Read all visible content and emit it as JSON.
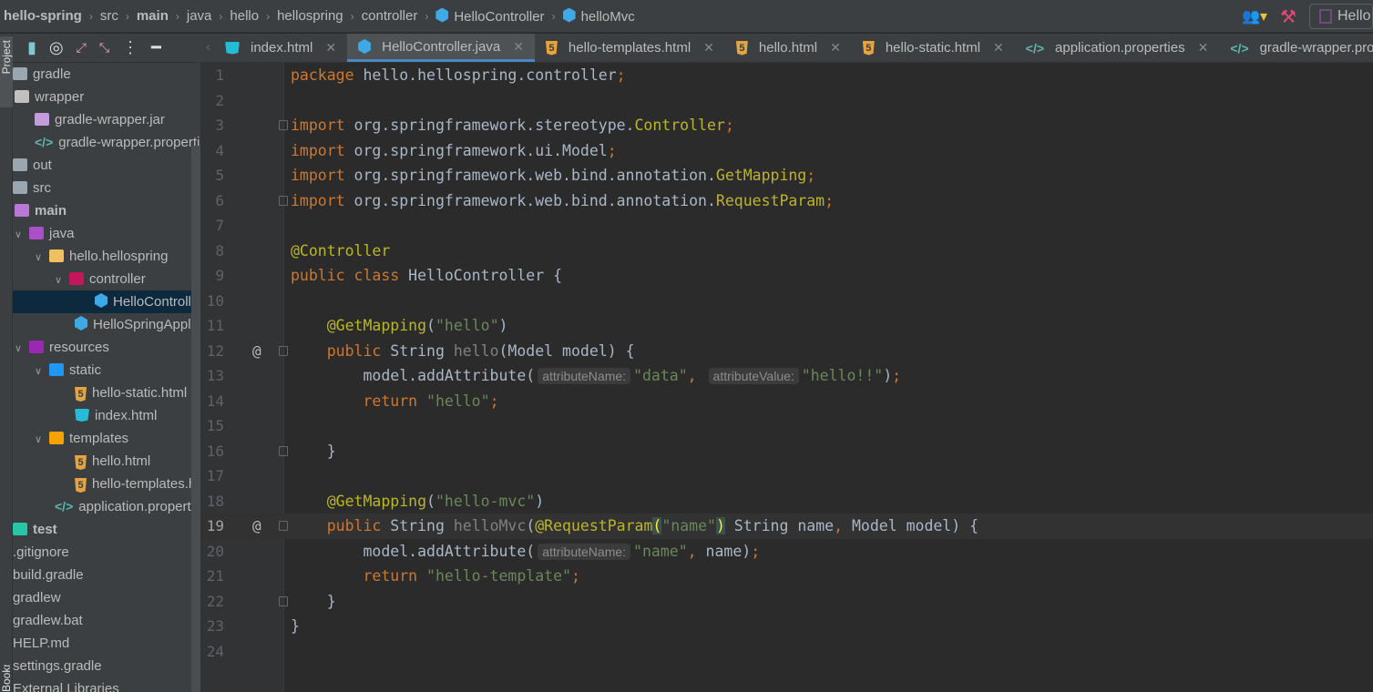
{
  "breadcrumb": [
    {
      "t": "hello-spring",
      "b": true
    },
    {
      "t": "src"
    },
    {
      "t": "main",
      "b": true
    },
    {
      "t": "java"
    },
    {
      "t": "hello"
    },
    {
      "t": "hellospring"
    },
    {
      "t": "controller"
    },
    {
      "t": "HelloController",
      "icon": "class"
    },
    {
      "t": "helloMvc",
      "icon": "method"
    }
  ],
  "run_config": "Hello",
  "left_stripe": {
    "project": "Project",
    "bookmarks": "Bookmarks"
  },
  "tree": [
    {
      "label": "gradle",
      "d": 0,
      "ico": "folder"
    },
    {
      "label": "wrapper",
      "d": 1,
      "ico": "folder-grey"
    },
    {
      "label": "gradle-wrapper.jar",
      "d": 2,
      "ico": "jar"
    },
    {
      "label": "gradle-wrapper.properties",
      "d": 2,
      "ico": "xml"
    },
    {
      "label": "out",
      "d": 0,
      "ico": "folder"
    },
    {
      "label": "src",
      "d": 0,
      "ico": "folder"
    },
    {
      "label": "main",
      "d": 1,
      "ico": "folder-src",
      "bold": true
    },
    {
      "label": "java",
      "d": 1,
      "ico": "folder-java",
      "arrow": true
    },
    {
      "label": "hello.hellospring",
      "d": 2,
      "ico": "package",
      "arrow": true
    },
    {
      "label": "controller",
      "d": 3,
      "ico": "package-spring",
      "arrow": true
    },
    {
      "label": "HelloController",
      "d": 5,
      "ico": "class",
      "selected": true
    },
    {
      "label": "HelloSpringApplication",
      "d": 4,
      "ico": "class-run"
    },
    {
      "label": "resources",
      "d": 1,
      "ico": "folder-res",
      "arrow": true
    },
    {
      "label": "static",
      "d": 2,
      "ico": "folder-web",
      "arrow": true
    },
    {
      "label": "hello-static.html",
      "d": 4,
      "ico": "html"
    },
    {
      "label": "index.html",
      "d": 4,
      "ico": "html-blue"
    },
    {
      "label": "templates",
      "d": 2,
      "ico": "folder-tpl",
      "arrow": true
    },
    {
      "label": "hello.html",
      "d": 4,
      "ico": "html"
    },
    {
      "label": "hello-templates.html",
      "d": 4,
      "ico": "html"
    },
    {
      "label": "application.properties",
      "d": 3,
      "ico": "xml"
    },
    {
      "label": "test",
      "d": 0,
      "ico": "folder-test",
      "bold": true
    },
    {
      "label": ".gitignore",
      "d": 0
    },
    {
      "label": "build.gradle",
      "d": 0
    },
    {
      "label": "gradlew",
      "d": 0
    },
    {
      "label": "gradlew.bat",
      "d": 0
    },
    {
      "label": "HELP.md",
      "d": 0
    },
    {
      "label": "settings.gradle",
      "d": 0
    },
    {
      "label": "External Libraries",
      "d": 0
    }
  ],
  "tabs": [
    {
      "label": "index.html",
      "ico": "html-blue"
    },
    {
      "label": "HelloController.java",
      "ico": "class",
      "active": true
    },
    {
      "label": "hello-templates.html",
      "ico": "html"
    },
    {
      "label": "hello.html",
      "ico": "html"
    },
    {
      "label": "hello-static.html",
      "ico": "html"
    },
    {
      "label": "application.properties",
      "ico": "xml"
    },
    {
      "label": "gradle-wrapper.properties",
      "ico": "xml"
    }
  ],
  "editor": {
    "current_line": 19,
    "lines": [
      {
        "n": "1",
        "t": [
          [
            "kw",
            "package "
          ],
          [
            "pl",
            "hello.hellospring.controller"
          ],
          [
            "kw",
            ";"
          ]
        ]
      },
      {
        "n": "2",
        "t": []
      },
      {
        "n": "3",
        "fold": true,
        "t": [
          [
            "kw",
            "import "
          ],
          [
            "pl",
            "org.springframework.stereotype."
          ],
          [
            "ann",
            "Controller"
          ],
          [
            "kw",
            ";"
          ]
        ]
      },
      {
        "n": "4",
        "t": [
          [
            "kw",
            "import "
          ],
          [
            "pl",
            "org.springframework.ui.Model"
          ],
          [
            "kw",
            ";"
          ]
        ]
      },
      {
        "n": "5",
        "t": [
          [
            "kw",
            "import "
          ],
          [
            "pl",
            "org.springframework.web.bind.annotation."
          ],
          [
            "ann",
            "GetMapping"
          ],
          [
            "kw",
            ";"
          ]
        ]
      },
      {
        "n": "6",
        "fold": true,
        "t": [
          [
            "kw",
            "import "
          ],
          [
            "pl",
            "org.springframework.web.bind.annotation."
          ],
          [
            "ann",
            "RequestParam"
          ],
          [
            "kw",
            ";"
          ]
        ]
      },
      {
        "n": "7",
        "t": []
      },
      {
        "n": "8",
        "t": [
          [
            "ann",
            "@Controller"
          ]
        ]
      },
      {
        "n": "9",
        "t": [
          [
            "kw",
            "public class "
          ],
          [
            "pl",
            "HelloController {"
          ]
        ]
      },
      {
        "n": "10",
        "t": []
      },
      {
        "n": "11",
        "t": [
          [
            "pl",
            "    "
          ],
          [
            "ann",
            "@GetMapping"
          ],
          [
            "pl",
            "("
          ],
          [
            "str",
            "\"hello\""
          ],
          [
            "pl",
            ")"
          ]
        ]
      },
      {
        "n": "12",
        "mark": "@",
        "fold": true,
        "t": [
          [
            "kw",
            "    public "
          ],
          [
            "pl",
            "String "
          ],
          [
            "unused",
            "hello"
          ],
          [
            "pl",
            "(Model model) {"
          ]
        ]
      },
      {
        "n": "13",
        "t": [
          [
            "pl",
            "        model.addAttribute("
          ],
          [
            "hint",
            "attributeName:"
          ],
          [
            "str",
            "\"data\""
          ],
          [
            "kw",
            ", "
          ],
          [
            "hint",
            "attributeValue:"
          ],
          [
            "str",
            "\"hello!!\""
          ],
          [
            "pl",
            ")"
          ],
          [
            "kw",
            ";"
          ]
        ]
      },
      {
        "n": "14",
        "t": [
          [
            "kw",
            "        return "
          ],
          [
            "str",
            "\"hello\""
          ],
          [
            "kw",
            ";"
          ]
        ]
      },
      {
        "n": "15",
        "t": []
      },
      {
        "n": "16",
        "fold": true,
        "t": [
          [
            "pl",
            "    }"
          ]
        ]
      },
      {
        "n": "17",
        "t": []
      },
      {
        "n": "18",
        "t": [
          [
            "pl",
            "    "
          ],
          [
            "ann",
            "@GetMapping"
          ],
          [
            "pl",
            "("
          ],
          [
            "str",
            "\"hello-mvc\""
          ],
          [
            "pl",
            ")"
          ]
        ]
      },
      {
        "n": "19",
        "mark": "@",
        "fold": true,
        "t": [
          [
            "kw",
            "    public "
          ],
          [
            "pl",
            "String "
          ],
          [
            "unused",
            "helloMvc"
          ],
          [
            "pl",
            "("
          ],
          [
            "ann",
            "@RequestParam"
          ],
          [
            "brace",
            "("
          ],
          [
            "str",
            "\"name\""
          ],
          [
            "brace",
            ")"
          ],
          [
            "pl",
            " String name"
          ],
          [
            "kw",
            ", "
          ],
          [
            "pl",
            "Model model) {"
          ]
        ]
      },
      {
        "n": "20",
        "t": [
          [
            "pl",
            "        model.addAttribute("
          ],
          [
            "hint",
            "attributeName:"
          ],
          [
            "str",
            "\"name\""
          ],
          [
            "kw",
            ", "
          ],
          [
            "pl",
            "name)"
          ],
          [
            "kw",
            ";"
          ]
        ]
      },
      {
        "n": "21",
        "t": [
          [
            "kw",
            "        return "
          ],
          [
            "str",
            "\"hello-template\""
          ],
          [
            "kw",
            ";"
          ]
        ]
      },
      {
        "n": "22",
        "fold": true,
        "t": [
          [
            "pl",
            "    }"
          ]
        ]
      },
      {
        "n": "23",
        "t": [
          [
            "pl",
            "}"
          ]
        ]
      },
      {
        "n": "24",
        "t": []
      }
    ]
  },
  "colors": {
    "keyword": "#CC7832",
    "annotation": "#BBB529",
    "string": "#6A8759",
    "text": "#A9B7C6",
    "accent": "#4A88C7"
  }
}
